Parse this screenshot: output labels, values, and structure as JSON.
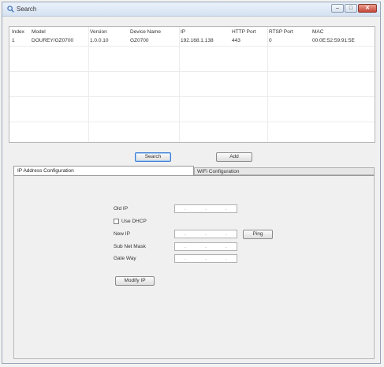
{
  "window": {
    "title": "Search"
  },
  "table": {
    "columns": [
      "Index",
      "Model",
      "Version",
      "Device Name",
      "IP",
      "HTTP Port",
      "RTSP Port",
      "MAC"
    ],
    "rows": [
      [
        "1",
        "DOUREY/GZ0700",
        "1.0.0.10",
        "GZ0700",
        "192.168.1.138",
        "443",
        "0",
        "00:0E:52:59:91:5E"
      ]
    ]
  },
  "buttons": {
    "search": "Search",
    "add": "Add"
  },
  "tabs": {
    "ip_config": "IP Address Configuration",
    "wifi_config": "WiFi Configuration"
  },
  "form": {
    "old_ip_label": "Old IP",
    "dhcp_label": "Use DHCP",
    "new_ip_label": "New IP",
    "subnet_label": "Sub Net Mask",
    "gateway_label": "Gate Way",
    "ping_label": "Ping",
    "modify_label": "Modify IP",
    "ip_dots": ".",
    "dhcp_checked": false
  }
}
